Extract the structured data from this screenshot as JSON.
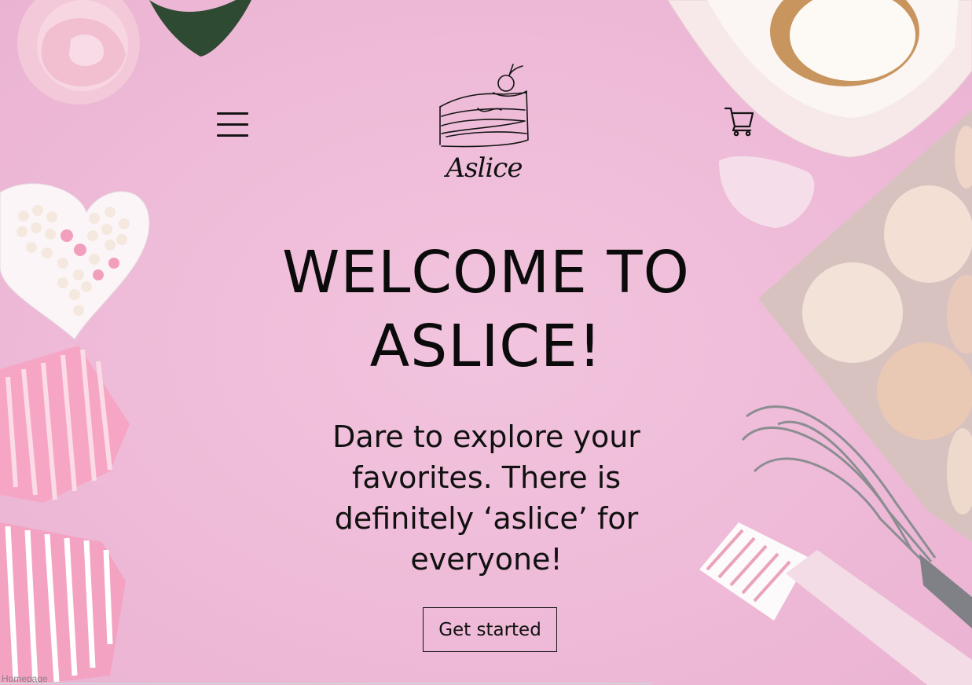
{
  "header": {
    "menu_icon": "hamburger-menu-icon",
    "cart_icon": "shopping-cart-icon",
    "logo_text": "Aslice",
    "logo_icon": "cake-slice-icon"
  },
  "hero": {
    "title_line1": "WELCOME TO",
    "title_line2": "ASLICE!",
    "subtitle_line1": "Dare to explore your",
    "subtitle_line2": "favorites. There is",
    "subtitle_line3": "definitely ‘aslice’ for",
    "subtitle_line4": "everyone!",
    "cta_label": "Get started"
  },
  "footer": {
    "page_label": "Homepage"
  },
  "colors": {
    "background": "#efbcd9",
    "text": "#111111"
  }
}
